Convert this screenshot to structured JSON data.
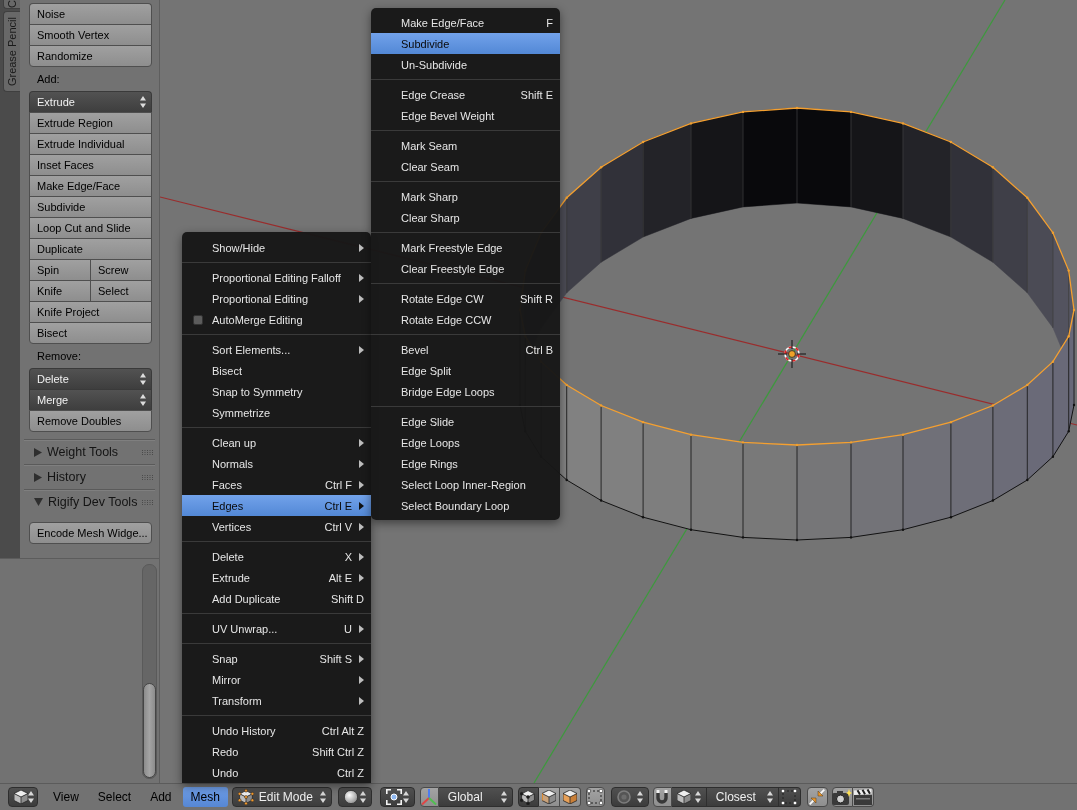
{
  "tool_shelf": {
    "tabs": [
      {
        "label": "C",
        "selected": false
      },
      {
        "label": "Grease Pencil",
        "selected": false
      }
    ],
    "sections": [
      {
        "items": [
          {
            "kind": "button",
            "label": "Noise"
          },
          {
            "kind": "button",
            "label": "Smooth Vertex"
          },
          {
            "kind": "button",
            "label": "Randomize"
          }
        ]
      },
      {
        "heading": "Add:",
        "items": [
          {
            "kind": "dropdown",
            "label": "Extrude"
          },
          {
            "kind": "button",
            "label": "Extrude Region"
          },
          {
            "kind": "button",
            "label": "Extrude Individual"
          },
          {
            "kind": "button",
            "label": "Inset Faces"
          },
          {
            "kind": "button",
            "label": "Make Edge/Face"
          },
          {
            "kind": "button",
            "label": "Subdivide"
          },
          {
            "kind": "button",
            "label": "Loop Cut and Slide"
          },
          {
            "kind": "button",
            "label": "Duplicate"
          },
          {
            "kind": "pair",
            "labels": [
              "Spin",
              "Screw"
            ]
          },
          {
            "kind": "pair",
            "labels": [
              "Knife",
              "Select"
            ]
          },
          {
            "kind": "button",
            "label": "Knife Project"
          },
          {
            "kind": "button",
            "label": "Bisect"
          }
        ]
      },
      {
        "heading": "Remove:",
        "items": [
          {
            "kind": "dropdown",
            "label": "Delete"
          },
          {
            "kind": "dropdown",
            "label": "Merge"
          },
          {
            "kind": "button",
            "label": "Remove Doubles"
          }
        ]
      }
    ],
    "panels": [
      {
        "title": "Weight Tools",
        "expanded": false
      },
      {
        "title": "History",
        "expanded": false
      },
      {
        "title": "Rigify Dev Tools",
        "expanded": true,
        "buttons": [
          "Encode Mesh Widge..."
        ]
      }
    ]
  },
  "mesh_menu": {
    "sections": [
      [
        {
          "kind": "command",
          "label": "Show/Hide",
          "submenu": true,
          "selected": false
        }
      ],
      [
        {
          "kind": "command",
          "label": "Proportional Editing Falloff",
          "submenu": true,
          "selected": false
        },
        {
          "kind": "command",
          "label": "Proportional Editing",
          "submenu": true,
          "selected": false
        },
        {
          "kind": "checkbox",
          "label": "AutoMerge Editing",
          "checked": false,
          "submenu": false,
          "selected": false
        }
      ],
      [
        {
          "kind": "command",
          "label": "Sort Elements...",
          "submenu": true,
          "selected": false
        },
        {
          "kind": "command",
          "label": "Bisect",
          "submenu": false,
          "selected": false
        },
        {
          "kind": "command",
          "label": "Snap to Symmetry",
          "submenu": false,
          "selected": false
        },
        {
          "kind": "command",
          "label": "Symmetrize",
          "submenu": false,
          "selected": false
        }
      ],
      [
        {
          "kind": "command",
          "label": "Clean up",
          "submenu": true,
          "selected": false
        },
        {
          "kind": "command",
          "label": "Normals",
          "submenu": true,
          "selected": false
        },
        {
          "kind": "command",
          "label": "Faces",
          "shortcut": "Ctrl F",
          "submenu": true,
          "selected": false
        },
        {
          "kind": "command",
          "label": "Edges",
          "shortcut": "Ctrl E",
          "submenu": true,
          "selected": true
        },
        {
          "kind": "command",
          "label": "Vertices",
          "shortcut": "Ctrl V",
          "submenu": true,
          "selected": false
        }
      ],
      [
        {
          "kind": "command",
          "label": "Delete",
          "shortcut": "X",
          "submenu": true,
          "selected": false
        },
        {
          "kind": "command",
          "label": "Extrude",
          "shortcut": "Alt E",
          "submenu": true,
          "selected": false
        },
        {
          "kind": "command",
          "label": "Add Duplicate",
          "shortcut": "Shift D",
          "submenu": false,
          "selected": false
        }
      ],
      [
        {
          "kind": "command",
          "label": "UV Unwrap...",
          "shortcut": "U",
          "submenu": true,
          "selected": false
        }
      ],
      [
        {
          "kind": "command",
          "label": "Snap",
          "shortcut": "Shift S",
          "submenu": true,
          "selected": false
        },
        {
          "kind": "command",
          "label": "Mirror",
          "submenu": true,
          "selected": false
        },
        {
          "kind": "command",
          "label": "Transform",
          "submenu": true,
          "selected": false
        }
      ],
      [
        {
          "kind": "command",
          "label": "Undo History",
          "shortcut": "Ctrl Alt Z",
          "submenu": false,
          "selected": false
        },
        {
          "kind": "command",
          "label": "Redo",
          "shortcut": "Shift Ctrl Z",
          "submenu": false,
          "selected": false
        },
        {
          "kind": "command",
          "label": "Undo",
          "shortcut": "Ctrl Z",
          "submenu": false,
          "selected": false
        }
      ]
    ]
  },
  "edges_submenu": {
    "sections": [
      [
        {
          "kind": "command",
          "label": "Make Edge/Face",
          "shortcut": "F",
          "submenu": false,
          "selected": false
        },
        {
          "kind": "command",
          "label": "Subdivide",
          "submenu": false,
          "selected": true
        },
        {
          "kind": "command",
          "label": "Un-Subdivide",
          "submenu": false,
          "selected": false
        }
      ],
      [
        {
          "kind": "command",
          "label": "Edge Crease",
          "shortcut": "Shift E",
          "submenu": false,
          "selected": false
        },
        {
          "kind": "command",
          "label": "Edge Bevel Weight",
          "submenu": false,
          "selected": false
        }
      ],
      [
        {
          "kind": "command",
          "label": "Mark Seam",
          "submenu": false,
          "selected": false
        },
        {
          "kind": "command",
          "label": "Clear Seam",
          "submenu": false,
          "selected": false
        }
      ],
      [
        {
          "kind": "command",
          "label": "Mark Sharp",
          "submenu": false,
          "selected": false
        },
        {
          "kind": "command",
          "label": "Clear Sharp",
          "submenu": false,
          "selected": false
        }
      ],
      [
        {
          "kind": "command",
          "label": "Mark Freestyle Edge",
          "submenu": false,
          "selected": false
        },
        {
          "kind": "command",
          "label": "Clear Freestyle Edge",
          "submenu": false,
          "selected": false
        }
      ],
      [
        {
          "kind": "command",
          "label": "Rotate Edge CW",
          "shortcut": "Shift R",
          "submenu": false,
          "selected": false
        },
        {
          "kind": "command",
          "label": "Rotate Edge CCW",
          "submenu": false,
          "selected": false
        }
      ],
      [
        {
          "kind": "command",
          "label": "Bevel",
          "shortcut": "Ctrl B",
          "submenu": false,
          "selected": false
        },
        {
          "kind": "command",
          "label": "Edge Split",
          "submenu": false,
          "selected": false
        },
        {
          "kind": "command",
          "label": "Bridge Edge Loops",
          "submenu": false,
          "selected": false
        }
      ],
      [
        {
          "kind": "command",
          "label": "Edge Slide",
          "submenu": false,
          "selected": false
        },
        {
          "kind": "command",
          "label": "Edge Loops",
          "submenu": false,
          "selected": false
        },
        {
          "kind": "command",
          "label": "Edge Rings",
          "submenu": false,
          "selected": false
        },
        {
          "kind": "command",
          "label": "Select Loop Inner-Region",
          "submenu": false,
          "selected": false
        },
        {
          "kind": "command",
          "label": "Select Boundary Loop",
          "submenu": false,
          "selected": false
        }
      ]
    ]
  },
  "header": {
    "menus": [
      {
        "label": "View",
        "selected": false
      },
      {
        "label": "Select",
        "selected": false
      },
      {
        "label": "Add",
        "selected": false
      },
      {
        "label": "Mesh",
        "selected": true
      }
    ],
    "mode": "Edit Mode",
    "orientation": "Global",
    "select_modes": [
      {
        "kind": "vertex",
        "selected": true
      },
      {
        "kind": "edge",
        "selected": false
      },
      {
        "kind": "face",
        "selected": false
      }
    ],
    "snap": {
      "on": false
    },
    "snap_target": "Closest"
  }
}
